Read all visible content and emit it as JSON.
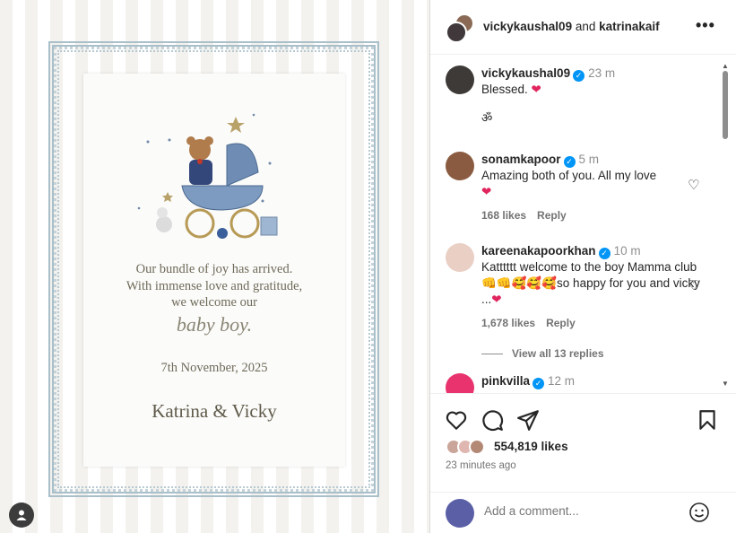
{
  "post": {
    "authors": {
      "first": "vickykaushal09",
      "joiner": "and",
      "second": "katrinakaif"
    },
    "card": {
      "line1": "Our bundle of joy has arrived.",
      "line2": "With immense love and gratitude,",
      "line3": "we welcome our",
      "line4": "baby boy.",
      "date": "7th November, 2025",
      "names": "Katrina & Vicky"
    }
  },
  "comments": [
    {
      "user": "vickykaushal09",
      "time": "23 m",
      "text": "Blessed.",
      "extra": "ॐ",
      "verified": true
    },
    {
      "user": "sonamkapoor",
      "time": "5 m",
      "text": "Amazing both of you. All my love",
      "likes": "168 likes",
      "reply": "Reply",
      "verified": true
    },
    {
      "user": "kareenakapoorkhan",
      "time": "10 m",
      "text": "Katttttt welcome to the boy Mamma club",
      "text2": "so happy for you and vicky ...",
      "likes": "1,678 likes",
      "reply": "Reply",
      "verified": true
    },
    {
      "user": "pinkvilla",
      "time": "12 m",
      "verified": true
    }
  ],
  "view_replies": "View all 13 replies",
  "likes_count": "554,819 likes",
  "posted_ago": "23 minutes ago",
  "add_comment_placeholder": "Add a comment...",
  "icons": [
    "more-icon",
    "like-icon",
    "comment-icon",
    "share-icon",
    "save-icon",
    "emoji-icon",
    "profile-icon"
  ],
  "colors": {
    "verified": "#0095f6",
    "heart": "#e0245e",
    "text": "#262626",
    "muted": "#737373"
  }
}
